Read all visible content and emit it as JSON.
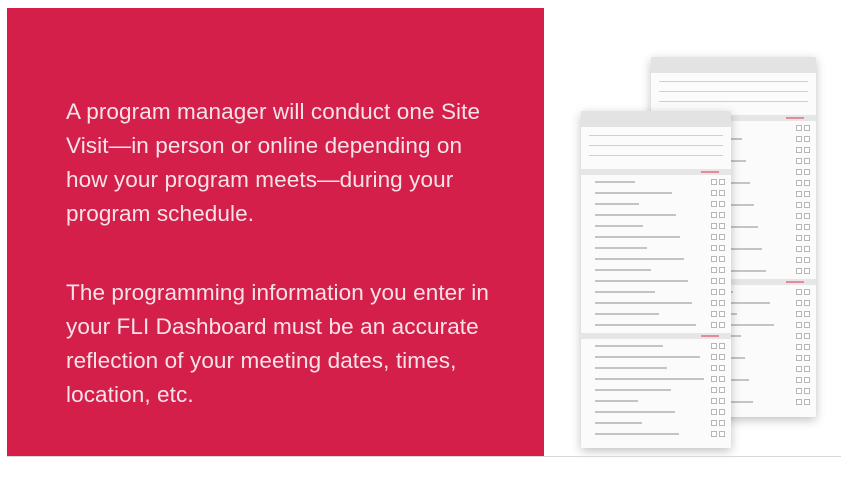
{
  "slide": {
    "paragraph_1": "A program manager will conduct one Site Visit—in person or online depending on how your program meets—during your program schedule.",
    "paragraph_2": "The programming information you enter in your FLI Dashboard must be an accurate reflection of your meeting dates, times, location, etc."
  },
  "colors": {
    "panel_red": "#d41f4b",
    "text": "#f6e3e8"
  },
  "illustration": {
    "description_icon": "form-documents-illustration"
  }
}
